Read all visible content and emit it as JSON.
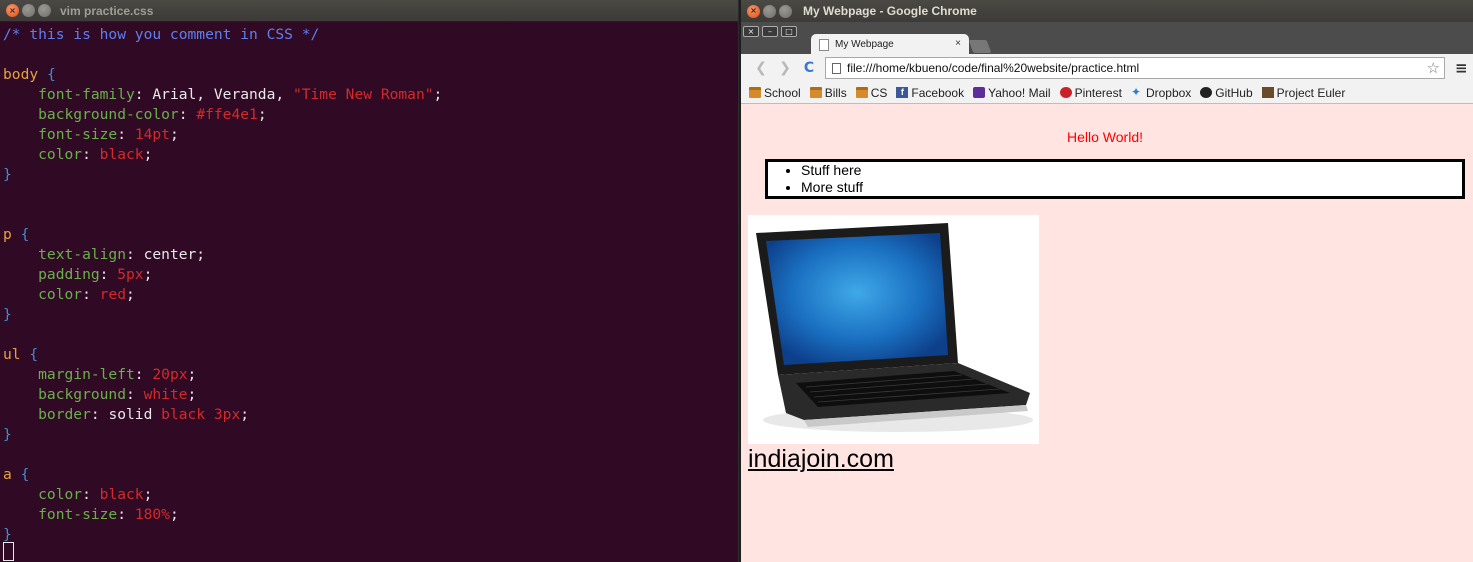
{
  "terminal": {
    "title": "vim practice.css",
    "lines": [
      [
        {
          "t": "/* this is how you comment in CSS */",
          "c": "comment"
        }
      ],
      [],
      [
        {
          "t": "body",
          "c": "sel"
        },
        {
          "t": " {",
          "c": "brace"
        }
      ],
      [
        {
          "t": "    font-family",
          "c": "prop"
        },
        {
          "t": ": Arial, Veranda, ",
          "c": "val"
        },
        {
          "t": "\"Time New Roman\"",
          "c": "num"
        },
        {
          "t": ";",
          "c": "punc"
        }
      ],
      [
        {
          "t": "    background-color",
          "c": "prop"
        },
        {
          "t": ": ",
          "c": "val"
        },
        {
          "t": "#ffe4e1",
          "c": "num"
        },
        {
          "t": ";",
          "c": "punc"
        }
      ],
      [
        {
          "t": "    font-size",
          "c": "prop"
        },
        {
          "t": ": ",
          "c": "val"
        },
        {
          "t": "14pt",
          "c": "num"
        },
        {
          "t": ";",
          "c": "punc"
        }
      ],
      [
        {
          "t": "    color",
          "c": "prop"
        },
        {
          "t": ": ",
          "c": "val"
        },
        {
          "t": "black",
          "c": "num"
        },
        {
          "t": ";",
          "c": "punc"
        }
      ],
      [
        {
          "t": "}",
          "c": "brace"
        }
      ],
      [],
      [],
      [
        {
          "t": "p",
          "c": "sel"
        },
        {
          "t": " {",
          "c": "brace"
        }
      ],
      [
        {
          "t": "    text-align",
          "c": "prop"
        },
        {
          "t": ": center;",
          "c": "val"
        }
      ],
      [
        {
          "t": "    padding",
          "c": "prop"
        },
        {
          "t": ": ",
          "c": "val"
        },
        {
          "t": "5px",
          "c": "num"
        },
        {
          "t": ";",
          "c": "punc"
        }
      ],
      [
        {
          "t": "    color",
          "c": "prop"
        },
        {
          "t": ": ",
          "c": "val"
        },
        {
          "t": "red",
          "c": "num"
        },
        {
          "t": ";",
          "c": "punc"
        }
      ],
      [
        {
          "t": "}",
          "c": "brace"
        }
      ],
      [],
      [
        {
          "t": "ul",
          "c": "sel"
        },
        {
          "t": " {",
          "c": "brace"
        }
      ],
      [
        {
          "t": "    margin-left",
          "c": "prop"
        },
        {
          "t": ": ",
          "c": "val"
        },
        {
          "t": "20px",
          "c": "num"
        },
        {
          "t": ";",
          "c": "punc"
        }
      ],
      [
        {
          "t": "    background",
          "c": "prop"
        },
        {
          "t": ": ",
          "c": "val"
        },
        {
          "t": "white",
          "c": "num"
        },
        {
          "t": ";",
          "c": "punc"
        }
      ],
      [
        {
          "t": "    border",
          "c": "prop"
        },
        {
          "t": ": solid ",
          "c": "val"
        },
        {
          "t": "black 3px",
          "c": "num"
        },
        {
          "t": ";",
          "c": "punc"
        }
      ],
      [
        {
          "t": "}",
          "c": "brace"
        }
      ],
      [],
      [
        {
          "t": "a",
          "c": "sel"
        },
        {
          "t": " {",
          "c": "brace"
        }
      ],
      [
        {
          "t": "    color",
          "c": "prop"
        },
        {
          "t": ": ",
          "c": "val"
        },
        {
          "t": "black",
          "c": "num"
        },
        {
          "t": ";",
          "c": "punc"
        }
      ],
      [
        {
          "t": "    font-size",
          "c": "prop"
        },
        {
          "t": ": ",
          "c": "val"
        },
        {
          "t": "180%",
          "c": "num"
        },
        {
          "t": ";",
          "c": "punc"
        }
      ],
      [
        {
          "t": "}",
          "c": "brace"
        }
      ]
    ]
  },
  "chrome": {
    "window_title": "My Webpage - Google Chrome",
    "tab_title": "My Webpage",
    "tab_close": "×",
    "url": "file:///home/kbueno/code/final%20website/practice.html",
    "back_icon": "❮",
    "forward_icon": "❯",
    "reload_icon": "C",
    "star_icon": "☆",
    "menu_icon": "≡",
    "bookmarks": [
      {
        "label": "School",
        "icon": "folder-icon"
      },
      {
        "label": "Bills",
        "icon": "folder-icon"
      },
      {
        "label": "CS",
        "icon": "folder-icon"
      },
      {
        "label": "Facebook",
        "icon": "fb-icon"
      },
      {
        "label": "Yahoo! Mail",
        "icon": "yahoo-icon"
      },
      {
        "label": "Pinterest",
        "icon": "pin-icon"
      },
      {
        "label": "Dropbox",
        "icon": "drop-icon"
      },
      {
        "label": "GitHub",
        "icon": "gh-icon"
      },
      {
        "label": "Project Euler",
        "icon": "pe-icon"
      }
    ]
  },
  "page": {
    "hello": "Hello World!",
    "list_items": [
      "Stuff here",
      "More stuff"
    ],
    "link_text": "indiajoin.com",
    "background": "#ffe4e1"
  }
}
